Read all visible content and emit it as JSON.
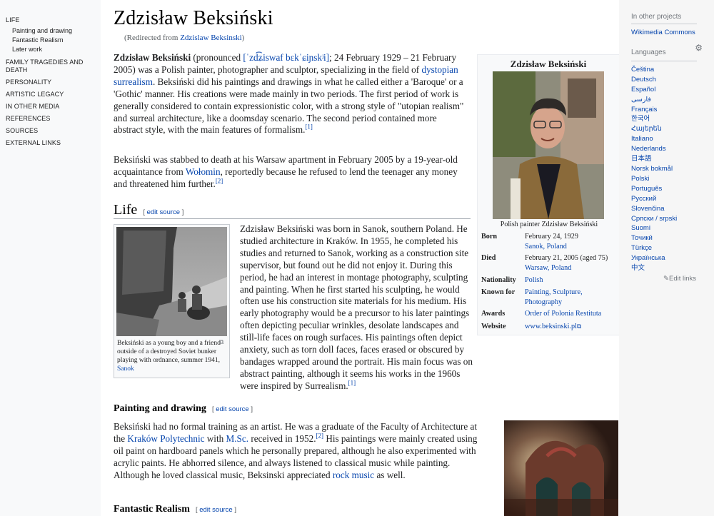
{
  "toc": {
    "items": [
      {
        "label": "LIFE",
        "sub": [
          "Painting and drawing",
          "Fantastic Realism",
          "Later work"
        ]
      },
      {
        "label": "FAMILY TRAGEDIES AND DEATH",
        "sub": []
      },
      {
        "label": "PERSONALITY",
        "sub": []
      },
      {
        "label": "ARTISTIC LEGACY",
        "sub": []
      },
      {
        "label": "IN OTHER MEDIA",
        "sub": []
      },
      {
        "label": "REFERENCES",
        "sub": []
      },
      {
        "label": "SOURCES",
        "sub": []
      },
      {
        "label": "EXTERNAL LINKS",
        "sub": []
      }
    ]
  },
  "article": {
    "title": "Zdzisław Beksiński",
    "redirect_prefix": "(Redirected from ",
    "redirect_link": "Zdzislaw Beksinski",
    "redirect_suffix": ")",
    "intro_name": "Zdzisław Beksiński",
    "intro_pron_prefix": " (pronounced ",
    "intro_ipa": "[ˈzd͡ʑiswaf bɛkˈɕiɲskʲi]",
    "intro_p1a": "; 24 February 1929 – 21 February 2005) was a Polish painter, photographer and sculptor, specializing in the field of ",
    "intro_link1": "dystopian surrealism",
    "intro_p1b": ". Beksiński did his paintings and drawings in what he called either a 'Baroque' or a 'Gothic' manner. His creations were made mainly in two periods. The first period of work is generally considered to contain expressionistic color, with a strong style of \"utopian realism\" and surreal architecture, like a doomsday scenario. The second period contained more abstract style, with the main features of formalism.",
    "ref1": "[1]",
    "intro_p2a": "Beksiński was stabbed to death at his Warsaw apartment in February 2005 by a 19-year-old acquaintance from ",
    "intro_link2": "Wołomin",
    "intro_p2b": ", reportedly because he refused to lend the teenager any money and threatened him further.",
    "ref2": "[2]",
    "edit_open": "[ ",
    "edit_label": "edit source",
    "edit_close": " ]",
    "life_heading": "Life",
    "life_text": "Zdzisław Beksiński was born in Sanok, southern Poland. He studied architecture in Kraków. In 1955, he completed his studies and returned to Sanok, working as a construction site supervisor, but found out he did not enjoy it. During this period, he had an interest in montage photography, sculpting and painting. When he first started his sculpting, he would often use his construction site materials for his medium. His early photography would be a precursor to his later paintings often depicting peculiar wrinkles, desolate landscapes and still-life faces on rough surfaces. His paintings often depict anxiety, such as torn doll faces, faces erased or obscured by bandages wrapped around the portrait. His main focus was on abstract painting, although it seems his works in the 1960s were inspired by Surrealism.",
    "life_ref": "[1]",
    "life_thumb_caption": "Beksiński as a young boy and a friend outside of a destroyed Soviet bunker playing with ordnance, summer 1941, ",
    "life_thumb_link": "Sanok",
    "painting_heading": "Painting and drawing",
    "painting_a": "Beksiński had no formal training as an artist. He was a graduate of the Faculty of Architecture at the ",
    "painting_link1": "Kraków Polytechnic",
    "painting_b": " with ",
    "painting_link2": "M.Sc.",
    "painting_c": " received in 1952.",
    "painting_ref": "[2]",
    "painting_d": " His paintings were mainly created using oil paint on hardboard panels which he personally prepared, although he also experimented with acrylic paints. He abhorred silence, and always listened to classical music while painting. Although he loved classical music, Beksinski appreciated ",
    "painting_link3": "rock music",
    "painting_e": " as well.",
    "fantastic_heading": "Fantastic Realism"
  },
  "infobox": {
    "title": "Zdzisław Beksiński",
    "caption": "Polish painter Zdzisław Beksiński",
    "born_label": "Born",
    "born_date": "February 24, 1929",
    "born_place": "Sanok, Poland",
    "died_label": "Died",
    "died_date": "February 21, 2005 (aged 75)",
    "died_place": "Warsaw, Poland",
    "nationality_label": "Nationality",
    "nationality": "Polish",
    "known_label": "Known for",
    "known_line1": "Painting, Sculpture,",
    "known_line2": "Photography",
    "awards_label": "Awards",
    "awards": "Order of Polonia Restituta",
    "website_label": "Website",
    "website": "www.beksinski.pl"
  },
  "rightbar": {
    "projects_header": "In other projects",
    "projects": [
      "Wikimedia Commons"
    ],
    "languages_header": "Languages",
    "languages": [
      "Čeština",
      "Deutsch",
      "Español",
      "فارسی",
      "Français",
      "한국어",
      "Հայերեն",
      "Italiano",
      "Nederlands",
      "日本語",
      "Norsk bokmål",
      "Polski",
      "Português",
      "Русский",
      "Slovenčina",
      "Српски / srpski",
      "Suomi",
      "Точикӣ",
      "Türkçe",
      "Українська",
      "中文"
    ],
    "edit_links": "Edit links"
  },
  "colors": {
    "link": "#0645ad",
    "sidebar_bg": "#f8f9fa",
    "right_bg": "#f6f6f6"
  }
}
